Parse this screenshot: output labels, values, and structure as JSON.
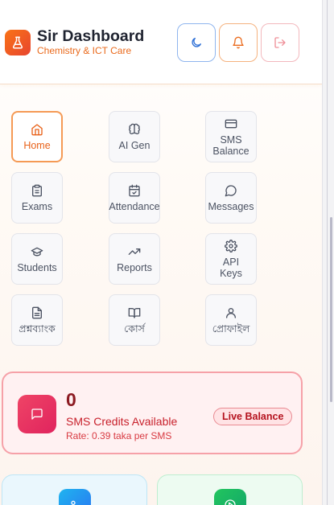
{
  "header": {
    "title": "Sir Dashboard",
    "subtitle": "Chemistry & ICT Care",
    "buttons": [
      {
        "icon": "moon-icon"
      },
      {
        "icon": "bell-icon"
      },
      {
        "icon": "logout-icon"
      }
    ]
  },
  "menu": {
    "items": [
      {
        "label": "Home",
        "icon": "home-icon",
        "active": true
      },
      {
        "label": "AI Gen",
        "icon": "brain-icon",
        "active": false
      },
      {
        "label": "SMS\nBalance",
        "icon": "credit-card-icon",
        "active": false
      },
      {
        "label": "Exams",
        "icon": "clipboard-icon",
        "active": false
      },
      {
        "label": "Attendance",
        "icon": "calendar-check-icon",
        "active": false
      },
      {
        "label": "Messages",
        "icon": "chat-bubble-icon",
        "active": false
      },
      {
        "label": "Students",
        "icon": "graduation-cap-icon",
        "active": false
      },
      {
        "label": "Reports",
        "icon": "trending-up-icon",
        "active": false
      },
      {
        "label": "API\nKeys",
        "icon": "gear-icon",
        "active": false
      },
      {
        "label": "প্রশ্নব্যাংক",
        "icon": "document-icon",
        "active": false
      },
      {
        "label": "কোর্স",
        "icon": "book-icon",
        "active": false
      },
      {
        "label": "প্রোফাইল",
        "icon": "user-icon",
        "active": false
      }
    ]
  },
  "sms": {
    "count": "0",
    "label": "SMS Credits Available",
    "rate": "Rate: 0.39 taka per SMS",
    "badge": "Live Balance",
    "icon": "message-icon"
  },
  "colors": {
    "accent": "#f97316",
    "danger": "#e0245e"
  }
}
